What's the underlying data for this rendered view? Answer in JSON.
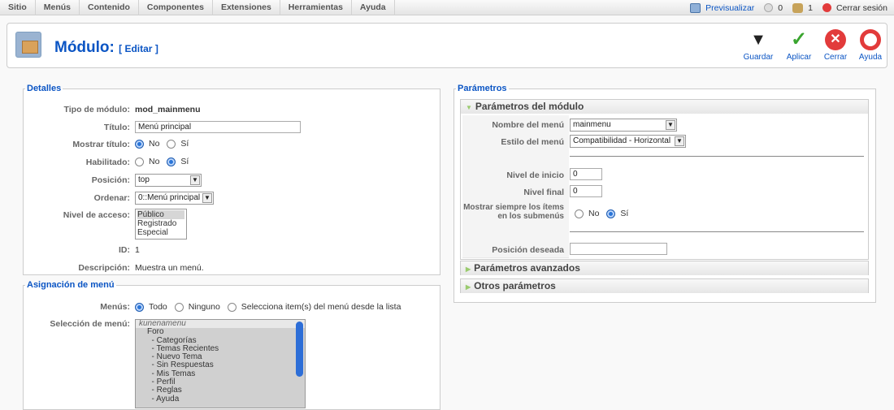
{
  "topbar": {
    "menus": [
      "Sitio",
      "Menús",
      "Contenido",
      "Componentes",
      "Extensiones",
      "Herramientas",
      "Ayuda"
    ],
    "preview": "Previsualizar",
    "messages": "0",
    "users": "1",
    "logout": "Cerrar sesión"
  },
  "toolbar": {
    "title": "Módulo:",
    "subtitle": "[ Editar ]",
    "save": "Guardar",
    "apply": "Aplicar",
    "close": "Cerrar",
    "help": "Ayuda"
  },
  "details": {
    "legend": "Detalles",
    "type_label": "Tipo de módulo:",
    "type_value": "mod_mainmenu",
    "title_label": "Título:",
    "title_value": "Menú principal",
    "show_title_label": "Mostrar título:",
    "no": "No",
    "yes": "Sí",
    "enabled_label": "Habilitado:",
    "position_label": "Posición:",
    "position_value": "top",
    "order_label": "Ordenar:",
    "order_value": "0::Menú principal",
    "access_label": "Nivel de acceso:",
    "access_options": [
      "Público",
      "Registrado",
      "Especial"
    ],
    "id_label": "ID:",
    "id_value": "1",
    "desc_label": "Descripción:",
    "desc_value": "Muestra un menú."
  },
  "assignment": {
    "legend": "Asignación de menú",
    "menus_label": "Menús:",
    "opt_all": "Todo",
    "opt_none": "Ninguno",
    "opt_select": "Selecciona item(s) del menú desde la lista",
    "selection_label": "Selección de menú:",
    "items": [
      "kunenamenu",
      "Foro",
      "  - Categorías",
      "  - Temas Recientes",
      "  - Nuevo Tema",
      "  - Sin Respuestas",
      "  - Mis Temas",
      "  - Perfil",
      "  - Reglas",
      "  - Ayuda"
    ]
  },
  "params": {
    "legend": "Parámetros",
    "module_params": "Parámetros del módulo",
    "menu_name_label": "Nombre del menú",
    "menu_name_value": "mainmenu",
    "menu_style_label": "Estilo del menú",
    "menu_style_value": "Compatibilidad - Horizontal",
    "start_level_label": "Nivel de inicio",
    "start_level_value": "0",
    "end_level_label": "Nivel final",
    "end_level_value": "0",
    "show_sub_label_1": "Mostrar siempre los ítems",
    "show_sub_label_2": "en los submenús",
    "no": "No",
    "yes": "Sí",
    "target_pos_label": "Posición deseada",
    "target_pos_value": "",
    "advanced": "Parámetros avanzados",
    "other": "Otros parámetros"
  },
  "colors": {
    "accent": "#0b55c4",
    "save_red": "#e23b3b",
    "apply_green": "#3aa52f"
  }
}
